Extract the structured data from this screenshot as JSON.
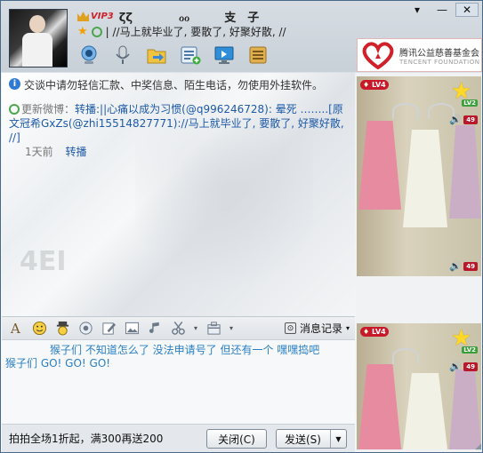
{
  "window_controls": {
    "menu": "▾",
    "minimize": "—",
    "close": "✕"
  },
  "contact": {
    "vip_label": "VIP3",
    "name": "ζζ　　　　ℴℴ　　　支　子",
    "signature": "| //马上就毕业了, 要散了, 好聚好散,  //"
  },
  "toolbar": {
    "buttons": [
      {
        "name": "video-call",
        "icon": "webcam-icon"
      },
      {
        "name": "voice-call",
        "icon": "microphone-icon"
      },
      {
        "name": "send-file",
        "icon": "folder-send-icon"
      },
      {
        "name": "create-group",
        "icon": "list-add-icon"
      },
      {
        "name": "remote-assist",
        "icon": "monitor-icon"
      },
      {
        "name": "apps",
        "icon": "app-box-icon"
      }
    ]
  },
  "ad": {
    "title": "腾讯公益慈善基金会",
    "subtitle": "TENCENT  FOUNDATION"
  },
  "chat": {
    "notice": "交谈中请勿轻信汇款、中奖信息、陌生电话，勿使用外挂软件。",
    "weibo_prefix": "更新微博：",
    "weibo_body": "转播:||心痛以成为习惯(@q996246728): 晕死  ……..[原文冠希GxZs(@zhi15514827771)://马上就毕业了, 要散了, 好聚好散,  //]",
    "weibo_time": "1天前",
    "weibo_forward": "转播"
  },
  "format_toolbar": {
    "history_label": "消息记录",
    "tools": [
      "font-icon",
      "emoji-icon",
      "face-magic-icon",
      "snapshot-icon",
      "edit-icon",
      "image-icon",
      "music-icon",
      "scissors-icon",
      "box-icon"
    ]
  },
  "input": {
    "line1": "猴子们   不知道怎么了  没法申请号了    但还有一个  嘿嘿捣吧",
    "line2": "猴子们    GO!  GO!  GO!"
  },
  "footer": {
    "promo": "拍拍全场1折起，满300再送200",
    "close_label": "关闭(C)",
    "send_label": "发送(S)"
  },
  "right_panel": {
    "shows": [
      {
        "level": "LV4",
        "star_level": "LV2",
        "count": "49"
      },
      {
        "level": "LV4",
        "star_level": "LV2",
        "count": "49"
      }
    ]
  },
  "colors": {
    "accent": "#1e5aa8",
    "input_text": "#2a7fc4",
    "badge": "#c8182a"
  }
}
